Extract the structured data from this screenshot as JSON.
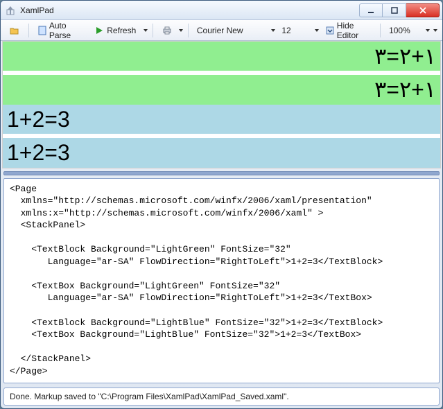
{
  "window": {
    "title": "XamlPad"
  },
  "toolbar": {
    "auto_parse": "Auto Parse",
    "refresh": "Refresh",
    "font_family": "Courier New",
    "font_size": "12",
    "hide_editor": "Hide Editor",
    "zoom": "100%"
  },
  "preview": {
    "rows": [
      {
        "text_ar": "١+٢=٣",
        "bg": "lightgreen",
        "dir": "rtl",
        "kind": "textblock"
      },
      {
        "text_ar": "١+٢=٣",
        "bg": "lightgreen",
        "dir": "rtl",
        "kind": "textbox"
      },
      {
        "text": "1+2=3",
        "bg": "lightblue",
        "dir": "ltr",
        "kind": "textblock"
      },
      {
        "text": "1+2=3",
        "bg": "lightblue",
        "dir": "ltr",
        "kind": "textbox"
      }
    ]
  },
  "editor": {
    "code": "<Page\n  xmlns=\"http://schemas.microsoft.com/winfx/2006/xaml/presentation\"\n  xmlns:x=\"http://schemas.microsoft.com/winfx/2006/xaml\" >\n  <StackPanel>\n\n    <TextBlock Background=\"LightGreen\" FontSize=\"32\"\n       Language=\"ar-SA\" FlowDirection=\"RightToLeft\">1+2=3</TextBlock>\n\n    <TextBox Background=\"LightGreen\" FontSize=\"32\"\n       Language=\"ar-SA\" FlowDirection=\"RightToLeft\">1+2=3</TextBox>\n\n    <TextBlock Background=\"LightBlue\" FontSize=\"32\">1+2=3</TextBlock>\n    <TextBox Background=\"LightBlue\" FontSize=\"32\">1+2=3</TextBox>\n\n  </StackPanel>\n</Page>"
  },
  "status": {
    "text": "Done. Markup saved to \"C:\\Program Files\\XamlPad\\XamlPad_Saved.xaml\"."
  }
}
